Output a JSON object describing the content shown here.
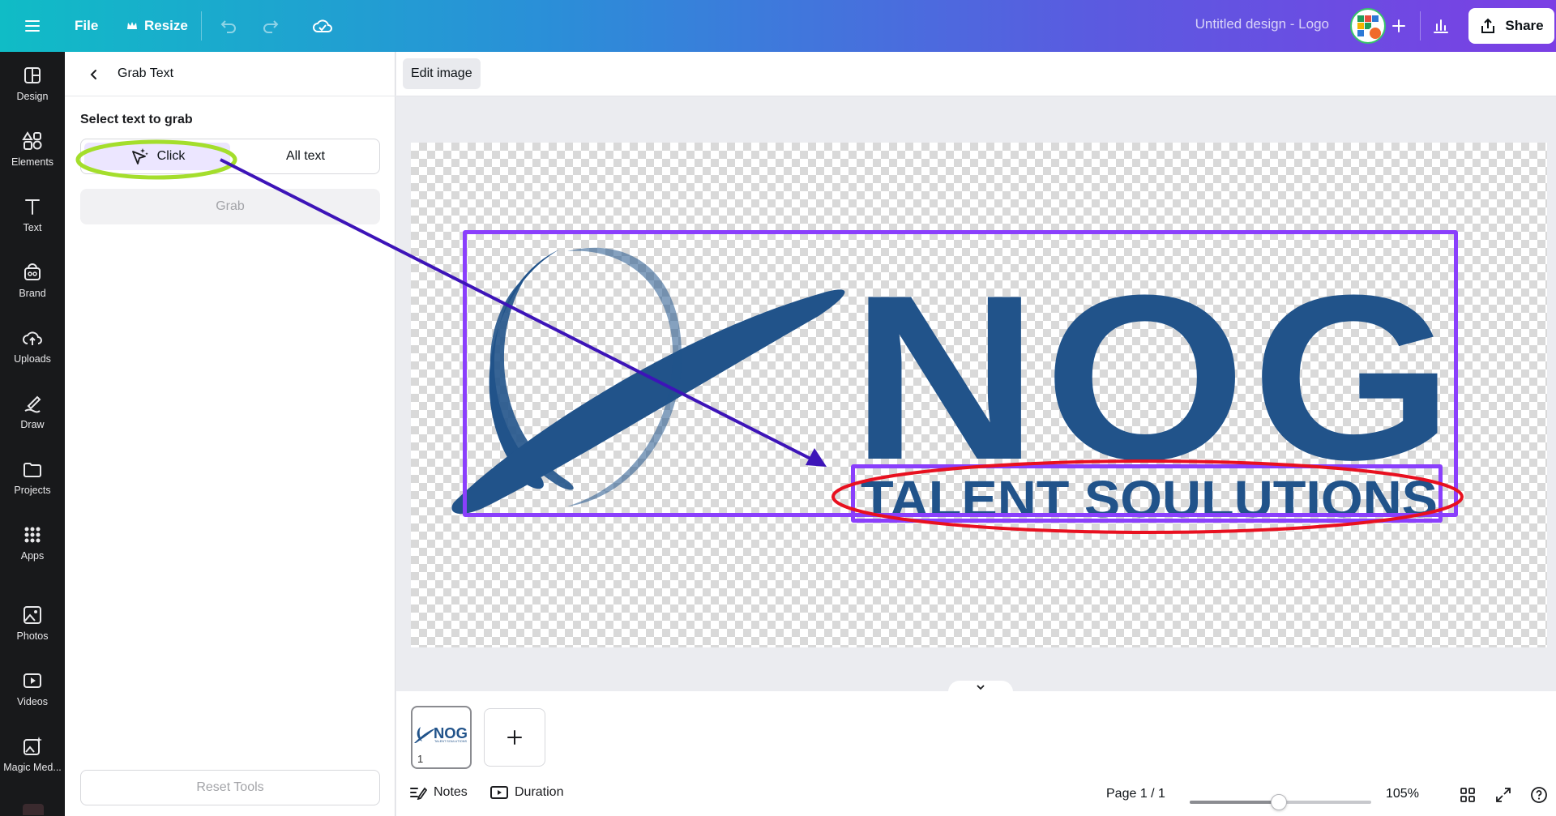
{
  "topbar": {
    "file_label": "File",
    "resize_label": "Resize",
    "doc_title": "Untitled design - Logo",
    "share_label": "Share",
    "icons": [
      "menu-icon",
      "crown-icon",
      "undo-icon",
      "redo-icon",
      "cloud-save-icon",
      "plus-icon",
      "insights-icon",
      "share-icon"
    ]
  },
  "rail": {
    "items": [
      {
        "label": "Design",
        "icon": "design-icon"
      },
      {
        "label": "Elements",
        "icon": "elements-icon"
      },
      {
        "label": "Text",
        "icon": "text-icon"
      },
      {
        "label": "Brand",
        "icon": "brand-icon"
      },
      {
        "label": "Uploads",
        "icon": "uploads-icon"
      },
      {
        "label": "Draw",
        "icon": "draw-icon"
      },
      {
        "label": "Projects",
        "icon": "projects-icon"
      },
      {
        "label": "Apps",
        "icon": "apps-icon"
      },
      {
        "label": "Photos",
        "icon": "photos-icon"
      },
      {
        "label": "Videos",
        "icon": "videos-icon"
      },
      {
        "label": "Magic Med...",
        "icon": "magic-media-icon"
      }
    ]
  },
  "panel": {
    "title": "Grab Text",
    "select_label": "Select text to grab",
    "mode_click": "Click",
    "mode_all": "All text",
    "selected_mode": "Click",
    "grab_label": "Grab",
    "reset_label": "Reset Tools"
  },
  "context": {
    "edit_image_label": "Edit image"
  },
  "logo": {
    "primary_text": "NOG",
    "secondary_text": "TALENT SOULUTIONS",
    "color": "#21538a"
  },
  "annotations": {
    "highlight_color": "#a4de2c",
    "arrow_color": "#3d14b8",
    "ellipse_color": "#e8101f",
    "selection_color": "#8a3ffc"
  },
  "pages": {
    "thumb_number": "1",
    "thumb_logo": "NOG",
    "thumb_sub": "TALENT SOULUTIONS"
  },
  "footer": {
    "notes_label": "Notes",
    "duration_label": "Duration",
    "page_indicator": "Page 1 / 1",
    "zoom": "105%",
    "zoom_fraction": 0.49
  }
}
